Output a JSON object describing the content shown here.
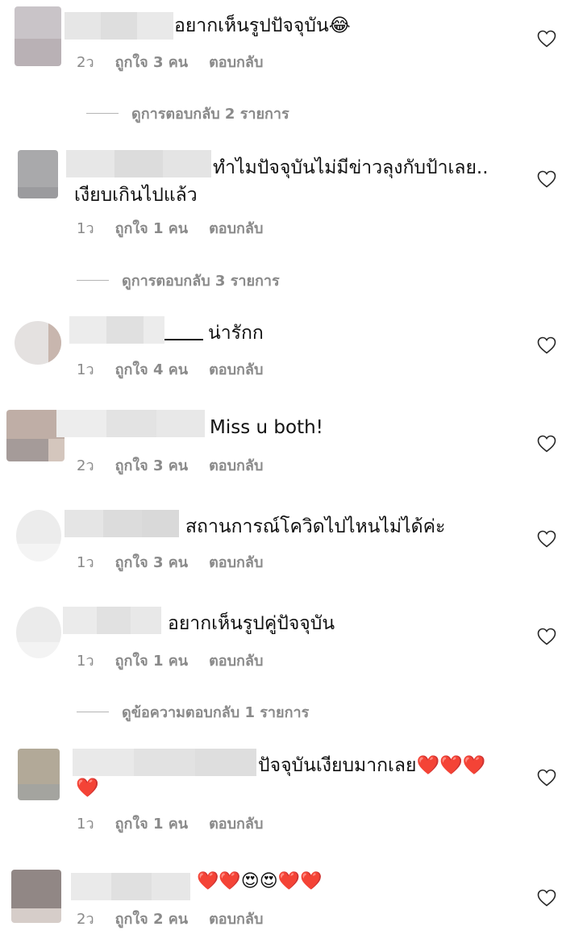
{
  "labels": {
    "likes_prefix": "ถูกใจ",
    "likes_suffix": "คน",
    "reply": "ตอบกลับ",
    "view_prefix": "ดูการตอบกลับ",
    "view_suffix": "รายการ",
    "view_messages_prefix": "ดูข้อความตอบกลับ"
  },
  "comments": [
    {
      "text": "อยากเห็นรูปปัจจุบัน😂",
      "time": "2ว",
      "likes": "ถูกใจ 3 คน",
      "reply": "ตอบกลับ",
      "view_replies": "ดูการตอบกลับ 2 รายการ"
    },
    {
      "text": "ทำไมปัจจุบันไม่มีข่าวลุงกับป้าเลย..",
      "text2": "เงียบเกินไปแล้ว",
      "time": "1ว",
      "likes": "ถูกใจ 1 คน",
      "reply": "ตอบกลับ",
      "view_replies": "ดูการตอบกลับ 3 รายการ"
    },
    {
      "text": "น่ารักก",
      "time": "1ว",
      "likes": "ถูกใจ 4 คน",
      "reply": "ตอบกลับ"
    },
    {
      "text": "Miss u both!",
      "time": "2ว",
      "likes": "ถูกใจ 3 คน",
      "reply": "ตอบกลับ"
    },
    {
      "text": "สถานการณ์โควิดไปไหนไม่ได้ค่ะ",
      "time": "1ว",
      "likes": "ถูกใจ 3 คน",
      "reply": "ตอบกลับ"
    },
    {
      "text": "อยากเห็นรูปคู่ปัจจุบัน",
      "time": "1ว",
      "likes": "ถูกใจ 1 คน",
      "reply": "ตอบกลับ",
      "view_replies": "ดูข้อความตอบกลับ 1 รายการ"
    },
    {
      "text": "ปัจจุบันเงียบมากเลย❤️❤️❤️",
      "text2": "❤️",
      "time": "1ว",
      "likes": "ถูกใจ 1 คน",
      "reply": "ตอบกลับ"
    },
    {
      "text": "❤️❤️😍😍❤️❤️",
      "time": "2ว",
      "likes": "ถูกใจ 2 คน",
      "reply": "ตอบกลับ"
    }
  ],
  "colors": {
    "meta": "#8a8a8a",
    "heart_outline": "#262626",
    "heart_red": "#e0245e"
  },
  "icons": {
    "like": "heart-outline-icon"
  }
}
